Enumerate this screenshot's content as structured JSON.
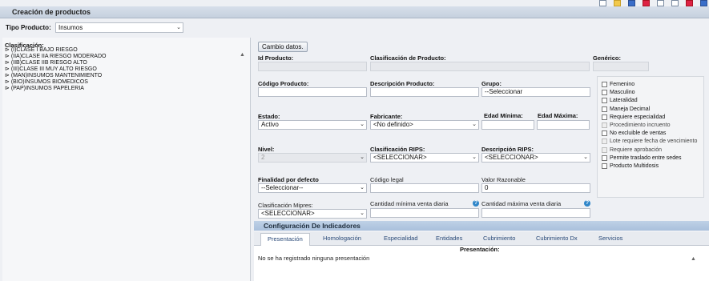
{
  "title": "Creación de productos",
  "tipo_producto": {
    "label": "Tipo Producto:",
    "value": "Insumos"
  },
  "clasificacion": {
    "label": "Clasificación:",
    "items": [
      "(I)CLASE I BAJO RIESGO",
      "(IIA)CLASE IIA RIESGO MODERADO",
      "(IIB)CLASE IIB RIESGO ALTO",
      "(III)CLASE III MUY ALTO RIESGO",
      "(MAN)INSUMOS MANTENIMIENTO",
      "(BIO)INSUMOS BIOMEDICOS",
      "(PAP)INSUMOS PAPELERIA"
    ]
  },
  "form": {
    "cambio_btn": "Cambio datos.",
    "id_producto": "Id Producto:",
    "clasificacion_producto": "Clasificación de Producto:",
    "generico": "Genérico:",
    "codigo_producto": "Código Producto:",
    "descripcion_producto": "Descripción Producto:",
    "grupo": {
      "label": "Grupo:",
      "value": "--Seleccionar"
    },
    "estado": {
      "label": "Estado:",
      "value": "Activo"
    },
    "fabricante": {
      "label": "Fabricante:",
      "value": "<No definido>"
    },
    "edad_minima": "Edad Mínima:",
    "edad_maxima": "Edad Máxima:",
    "nivel": {
      "label": "Nivel:",
      "value": "2"
    },
    "clasificacion_rips": {
      "label": "Clasificación RIPS:",
      "value": "<SELECCIONAR>"
    },
    "descripcion_rips": {
      "label": "Descripción RIPS:",
      "value": "<SELECCIONAR>"
    },
    "finalidad": {
      "label": "Finalidad por defecto",
      "value": "--Seleccionar--"
    },
    "codigo_legal": "Código legal",
    "valor_razonable": {
      "label": "Valor Razonable",
      "value": "0"
    },
    "clasificacion_mipres": {
      "label": "Clasificación Mipres:",
      "value": "<SELECCIONAR>"
    },
    "cantidad_minima": "Cantidad mínima venta diaria",
    "cantidad_maxima": "Cantidad máxima venta diaria"
  },
  "checkboxes": [
    {
      "label": "Femenino",
      "disabled": false
    },
    {
      "label": "Masculino",
      "disabled": false
    },
    {
      "label": "Lateralidad",
      "disabled": false
    },
    {
      "label": "Maneja Decimal",
      "disabled": false
    },
    {
      "label": "Requiere especialidad",
      "disabled": false
    },
    {
      "label": "Procedimiento incruento",
      "disabled": true
    },
    {
      "label": "No excluible de ventas",
      "disabled": false
    },
    {
      "label": "Lote requiere fecha de vencimiento",
      "disabled": true
    },
    {
      "label": "Requiere aprobación",
      "disabled": true
    },
    {
      "label": "Permite traslado entre sedes",
      "disabled": false
    },
    {
      "label": "Producto Multidosis",
      "disabled": false
    }
  ],
  "indicadores": {
    "title": "Configuración De Indicadores",
    "tabs": [
      "Presentación",
      "Homologación",
      "Especialidad",
      "Entidades",
      "Cubrimiento",
      "Cubrimiento Dx",
      "Servicios"
    ],
    "section_title": "Presentación:",
    "empty_text": "No se ha registrado ninguna presentación"
  }
}
